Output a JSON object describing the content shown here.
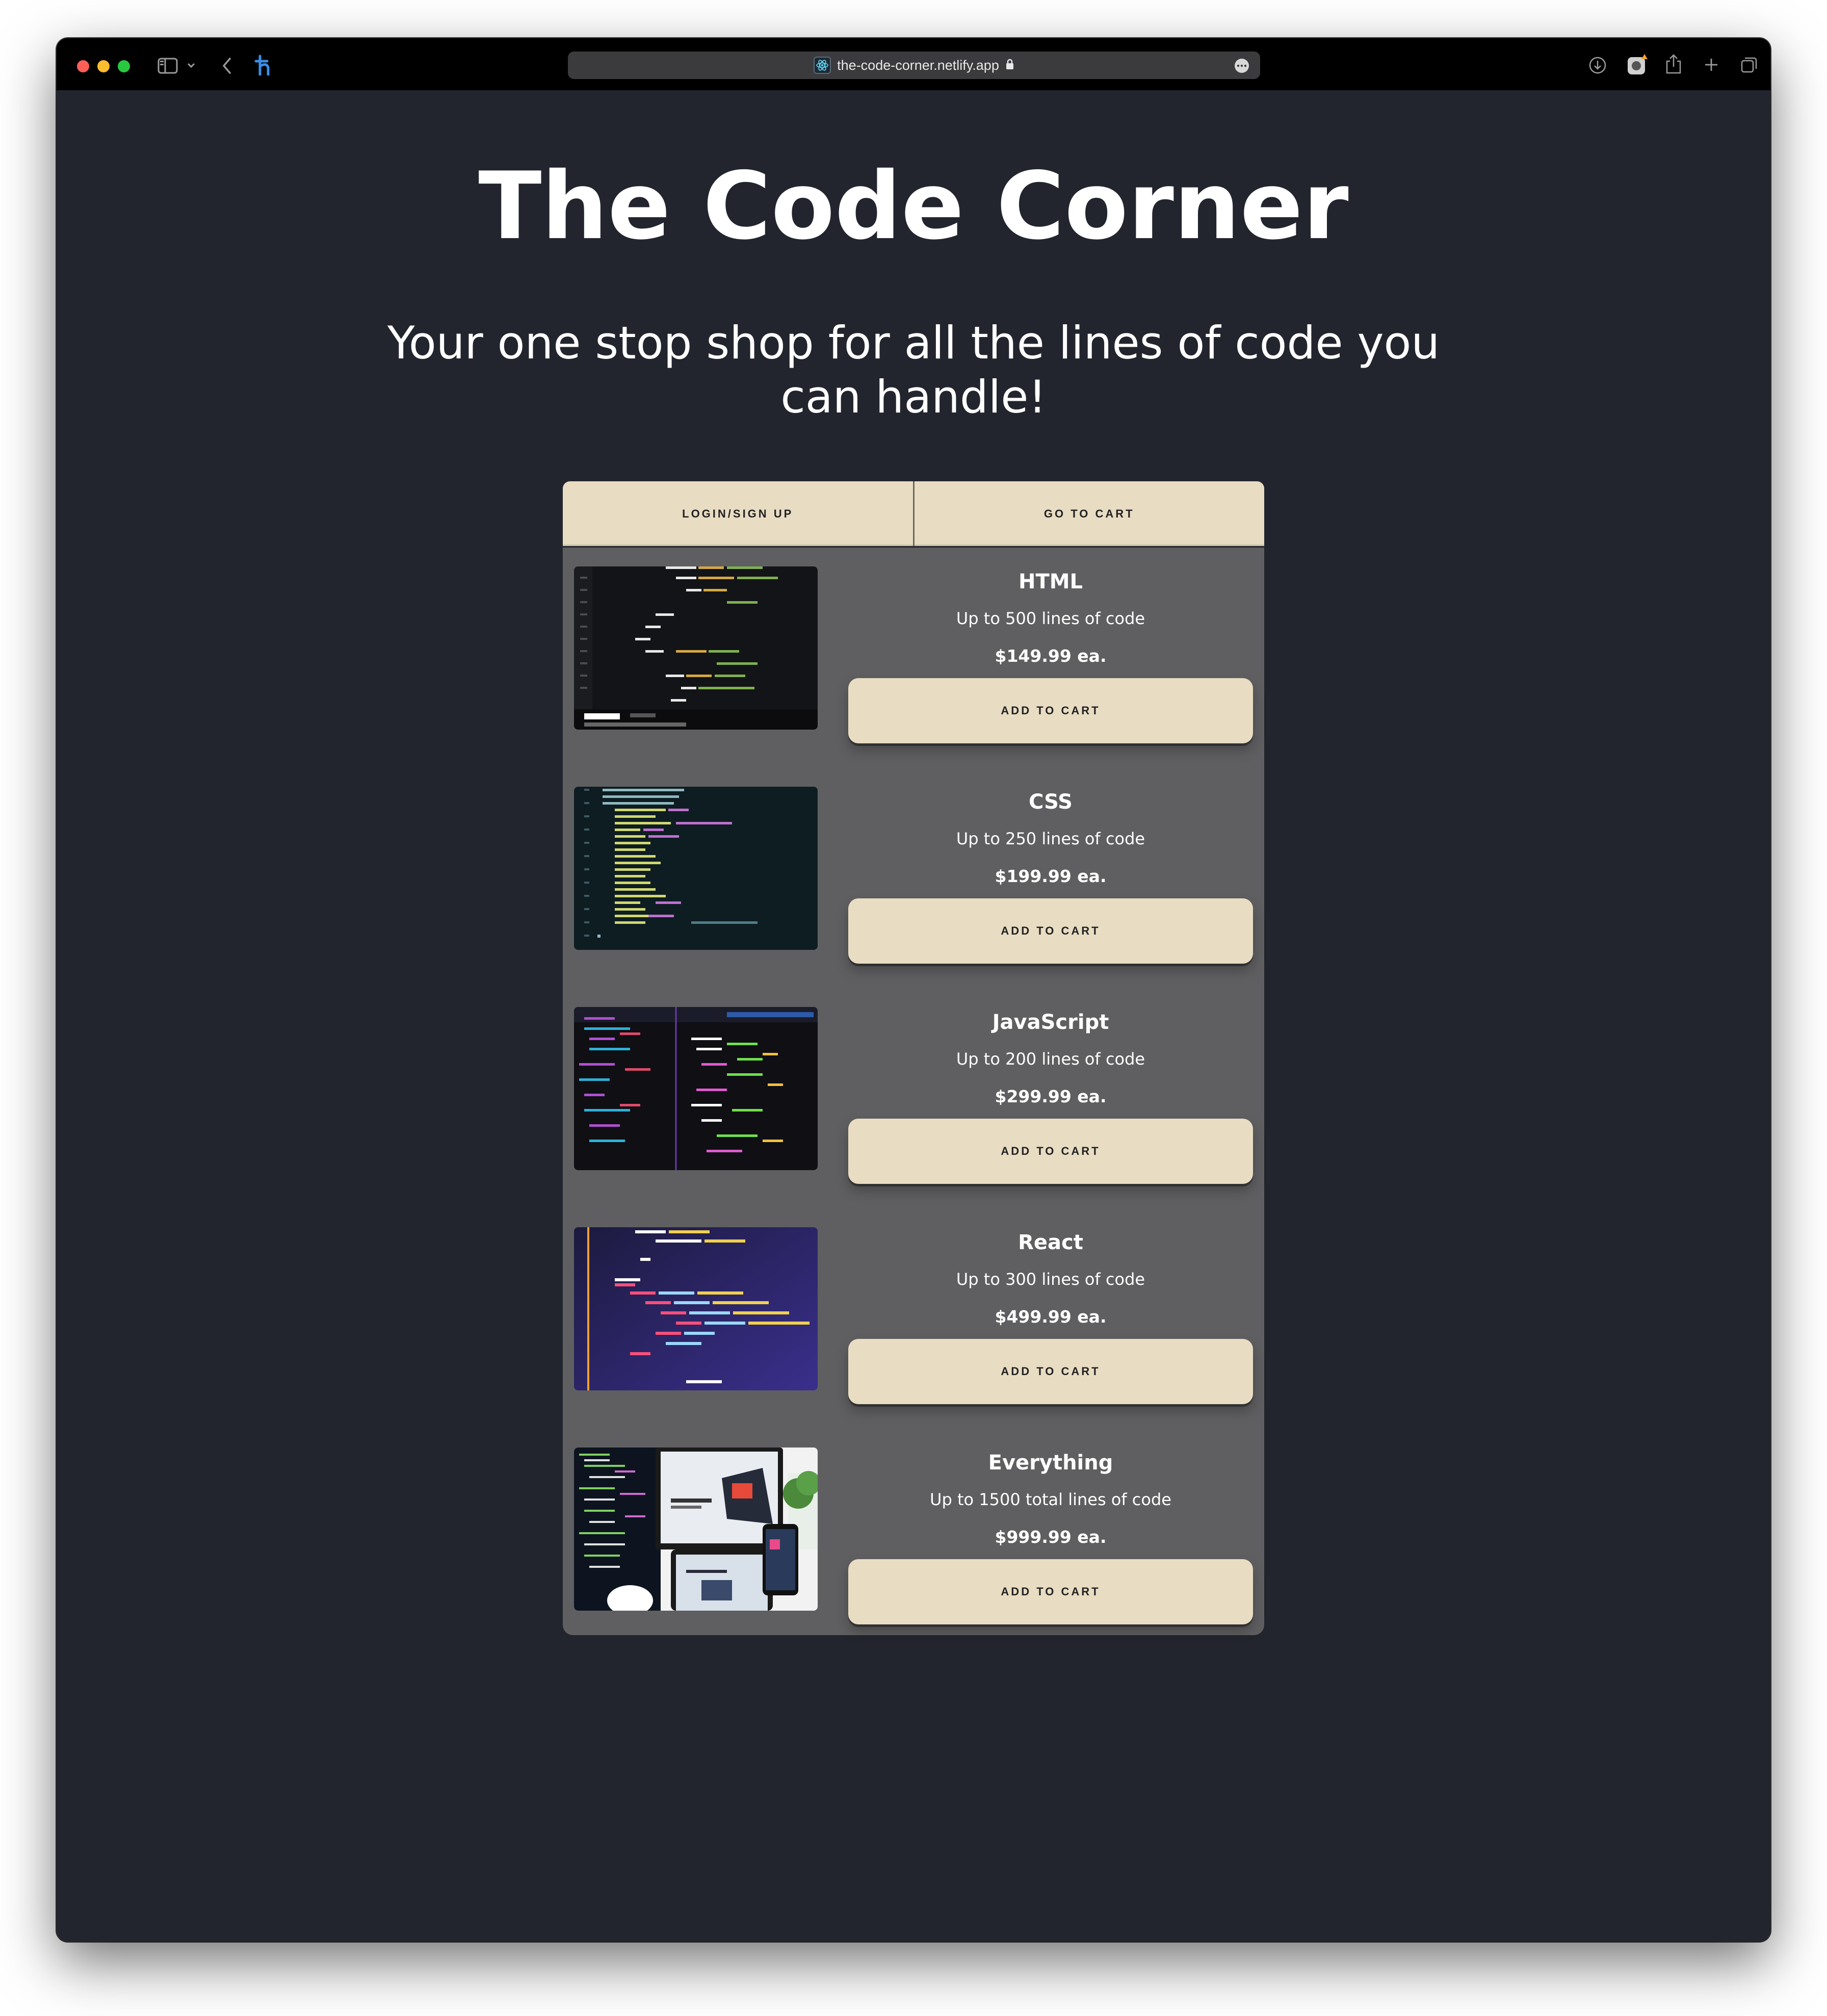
{
  "browser": {
    "url": "the-code-corner.netlify.app"
  },
  "page": {
    "title": "The Code Corner",
    "subtitle": "Your one stop shop for all the lines of code you can handle!"
  },
  "nav": {
    "login_label": "LOGIN/SIGN UP",
    "cart_label": "GO TO CART"
  },
  "products": [
    {
      "name": "HTML",
      "description": "Up to 500 lines of code",
      "price": "$149.99 ea.",
      "button": "ADD TO CART"
    },
    {
      "name": "CSS",
      "description": "Up to 250 lines of code",
      "price": "$199.99 ea.",
      "button": "ADD TO CART"
    },
    {
      "name": "JavaScript",
      "description": "Up to 200 lines of code",
      "price": "$299.99 ea.",
      "button": "ADD TO CART"
    },
    {
      "name": "React",
      "description": "Up to 300 lines of code",
      "price": "$499.99 ea.",
      "button": "ADD TO CART"
    },
    {
      "name": "Everything",
      "description": "Up to 1500 total lines of code",
      "price": "$999.99 ea.",
      "button": "ADD TO CART"
    }
  ],
  "colors": {
    "page_background": "#23252e",
    "panel_background": "#5f5f61",
    "button_background": "#e8dcc3"
  }
}
